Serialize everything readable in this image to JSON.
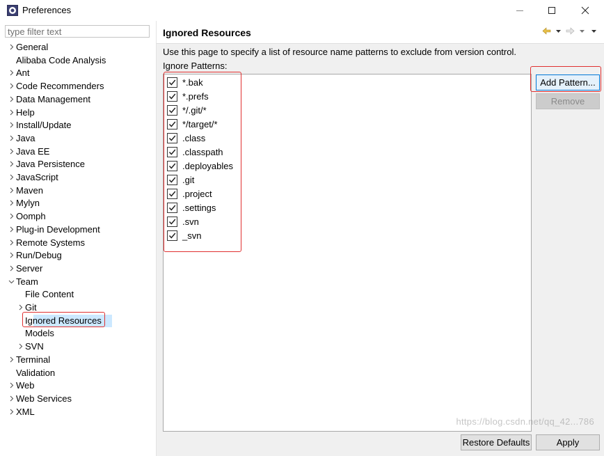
{
  "window": {
    "title": "Preferences"
  },
  "filter": {
    "placeholder": "type filter text"
  },
  "tree": [
    {
      "label": "General",
      "chevron": "right"
    },
    {
      "label": "Alibaba Code Analysis",
      "chevron": ""
    },
    {
      "label": "Ant",
      "chevron": "right"
    },
    {
      "label": "Code Recommenders",
      "chevron": "right"
    },
    {
      "label": "Data Management",
      "chevron": "right"
    },
    {
      "label": "Help",
      "chevron": "right"
    },
    {
      "label": "Install/Update",
      "chevron": "right"
    },
    {
      "label": "Java",
      "chevron": "right"
    },
    {
      "label": "Java EE",
      "chevron": "right"
    },
    {
      "label": "Java Persistence",
      "chevron": "right"
    },
    {
      "label": "JavaScript",
      "chevron": "right"
    },
    {
      "label": "Maven",
      "chevron": "right"
    },
    {
      "label": "Mylyn",
      "chevron": "right"
    },
    {
      "label": "Oomph",
      "chevron": "right"
    },
    {
      "label": "Plug-in Development",
      "chevron": "right"
    },
    {
      "label": "Remote Systems",
      "chevron": "right"
    },
    {
      "label": "Run/Debug",
      "chevron": "right"
    },
    {
      "label": "Server",
      "chevron": "right"
    },
    {
      "label": "Team",
      "chevron": "down"
    },
    {
      "label": "File Content",
      "chevron": "",
      "level": 1
    },
    {
      "label": "Git",
      "chevron": "right",
      "level": 1
    },
    {
      "label": "Ignored Resources",
      "chevron": "",
      "level": 1,
      "selected": true
    },
    {
      "label": "Models",
      "chevron": "",
      "level": 1
    },
    {
      "label": "SVN",
      "chevron": "right",
      "level": 1
    },
    {
      "label": "Terminal",
      "chevron": "right"
    },
    {
      "label": "Validation",
      "chevron": ""
    },
    {
      "label": "Web",
      "chevron": "right"
    },
    {
      "label": "Web Services",
      "chevron": "right"
    },
    {
      "label": "XML",
      "chevron": "right"
    }
  ],
  "page": {
    "title": "Ignored Resources",
    "description": "Use this page to specify a list of resource name patterns to exclude from version control.",
    "patterns_label": "Ignore Patterns:",
    "patterns": [
      {
        "label": "*.bak",
        "checked": true
      },
      {
        "label": "*.prefs",
        "checked": true
      },
      {
        "label": "*/.git/*",
        "checked": true
      },
      {
        "label": "*/target/*",
        "checked": true
      },
      {
        "label": ".class",
        "checked": true
      },
      {
        "label": ".classpath",
        "checked": true
      },
      {
        "label": ".deployables",
        "checked": true
      },
      {
        "label": ".git",
        "checked": true
      },
      {
        "label": ".project",
        "checked": true
      },
      {
        "label": ".settings",
        "checked": true
      },
      {
        "label": ".svn",
        "checked": true
      },
      {
        "label": "_svn",
        "checked": true
      }
    ],
    "add_pattern_label": "Add Pattern...",
    "remove_label": "Remove",
    "restore_defaults_label": "Restore Defaults",
    "apply_label": "Apply"
  },
  "watermark": "https://blog.csdn.net/qq_42...786",
  "colors": {
    "annotation": "#e03030",
    "selection": "#cce8ff",
    "focus": "#0078d7"
  }
}
